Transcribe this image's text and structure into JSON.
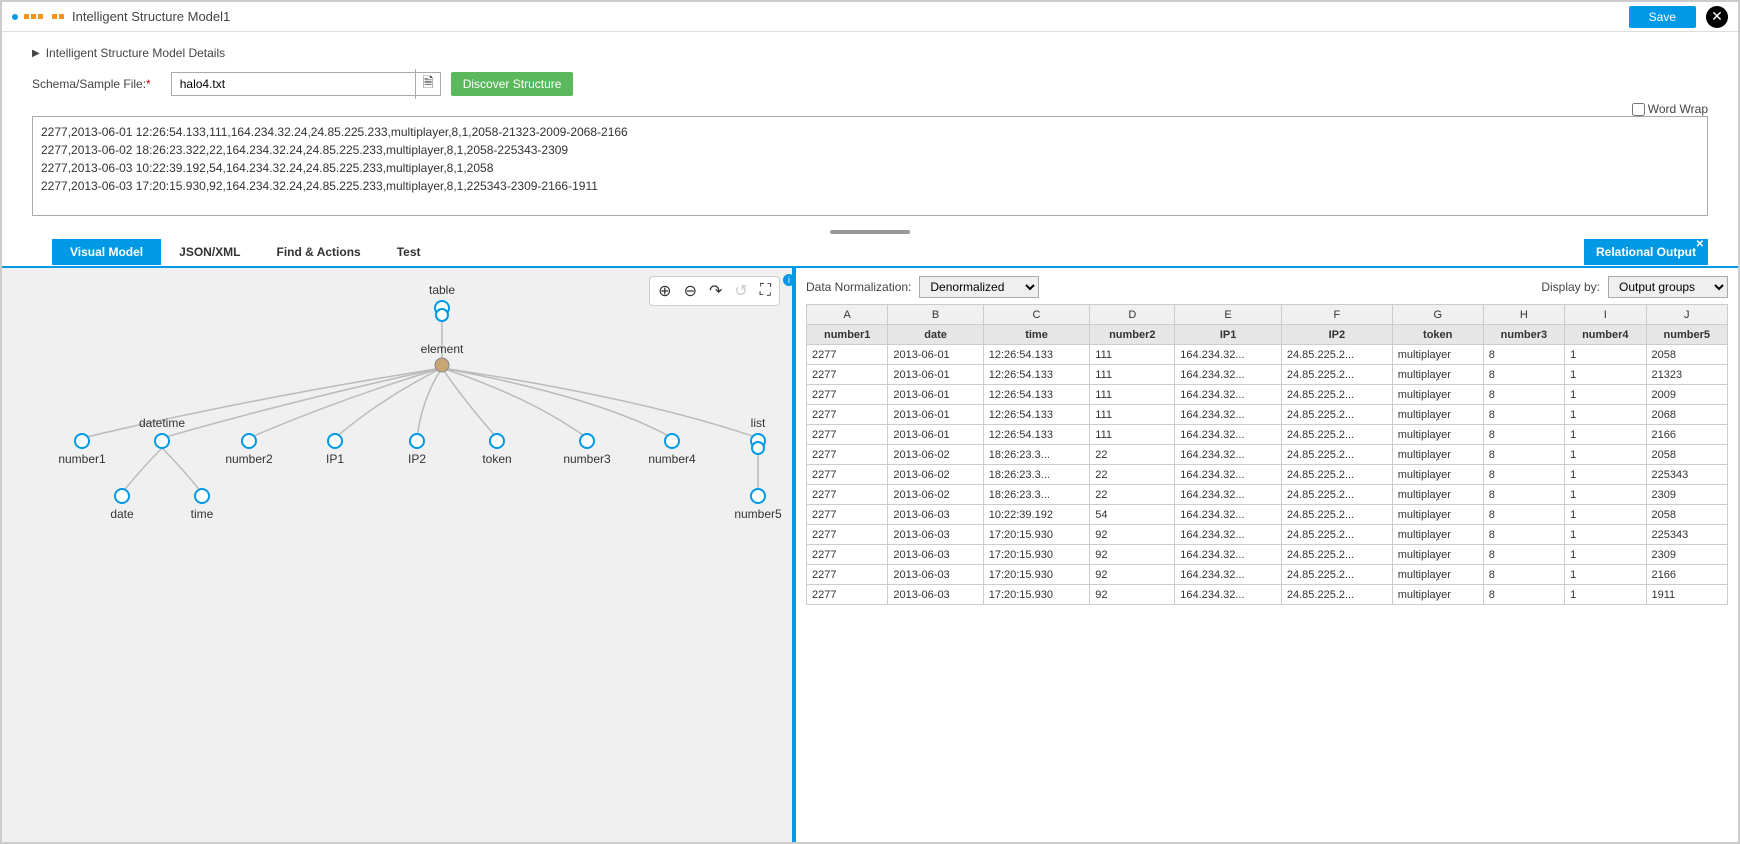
{
  "header": {
    "title": "Intelligent Structure Model1",
    "save_label": "Save"
  },
  "details": {
    "label": "Intelligent Structure Model Details"
  },
  "schema": {
    "label": "Schema/Sample File:",
    "filename": "halo4.txt",
    "discover_label": "Discover Structure",
    "wordwrap_label": "Word Wrap"
  },
  "sample_lines": [
    "2277,2013-06-01 12:26:54.133,111,164.234.32.24,24.85.225.233,multiplayer,8,1,2058-21323-2009-2068-2166",
    "2277,2013-06-02 18:26:23.322,22,164.234.32.24,24.85.225.233,multiplayer,8,1,2058-225343-2309",
    "2277,2013-06-03 10:22:39.192,54,164.234.32.24,24.85.225.233,multiplayer,8,1,2058",
    "2277,2013-06-03 17:20:15.930,92,164.234.32.24,24.85.225.233,multiplayer,8,1,225343-2309-2166-1911"
  ],
  "tabs": {
    "visual": "Visual Model",
    "json": "JSON/XML",
    "find": "Find & Actions",
    "test": "Test",
    "relational": "Relational Output"
  },
  "tree": {
    "table": "table",
    "element": "element",
    "number1": "number1",
    "datetime": "datetime",
    "number2": "number2",
    "ip1": "IP1",
    "ip2": "IP2",
    "token": "token",
    "number3": "number3",
    "number4": "number4",
    "list": "list",
    "date": "date",
    "time": "time",
    "number5": "number5"
  },
  "right": {
    "norm_label": "Data Normalization:",
    "norm_value": "Denormalized",
    "display_label": "Display by:",
    "display_value": "Output groups"
  },
  "grid": {
    "letters": [
      "A",
      "B",
      "C",
      "D",
      "E",
      "F",
      "G",
      "H",
      "I",
      "J"
    ],
    "headers": [
      "number1",
      "date",
      "time",
      "number2",
      "IP1",
      "IP2",
      "token",
      "number3",
      "number4",
      "number5"
    ],
    "rows": [
      [
        "2277",
        "2013-06-01",
        "12:26:54.133",
        "111",
        "164.234.32...",
        "24.85.225.2...",
        "multiplayer",
        "8",
        "1",
        "2058"
      ],
      [
        "2277",
        "2013-06-01",
        "12:26:54.133",
        "111",
        "164.234.32...",
        "24.85.225.2...",
        "multiplayer",
        "8",
        "1",
        "21323"
      ],
      [
        "2277",
        "2013-06-01",
        "12:26:54.133",
        "111",
        "164.234.32...",
        "24.85.225.2...",
        "multiplayer",
        "8",
        "1",
        "2009"
      ],
      [
        "2277",
        "2013-06-01",
        "12:26:54.133",
        "111",
        "164.234.32...",
        "24.85.225.2...",
        "multiplayer",
        "8",
        "1",
        "2068"
      ],
      [
        "2277",
        "2013-06-01",
        "12:26:54.133",
        "111",
        "164.234.32...",
        "24.85.225.2...",
        "multiplayer",
        "8",
        "1",
        "2166"
      ],
      [
        "2277",
        "2013-06-02",
        "18:26:23.3...",
        "22",
        "164.234.32...",
        "24.85.225.2...",
        "multiplayer",
        "8",
        "1",
        "2058"
      ],
      [
        "2277",
        "2013-06-02",
        "18:26:23.3...",
        "22",
        "164.234.32...",
        "24.85.225.2...",
        "multiplayer",
        "8",
        "1",
        "225343"
      ],
      [
        "2277",
        "2013-06-02",
        "18:26:23.3...",
        "22",
        "164.234.32...",
        "24.85.225.2...",
        "multiplayer",
        "8",
        "1",
        "2309"
      ],
      [
        "2277",
        "2013-06-03",
        "10:22:39.192",
        "54",
        "164.234.32...",
        "24.85.225.2...",
        "multiplayer",
        "8",
        "1",
        "2058"
      ],
      [
        "2277",
        "2013-06-03",
        "17:20:15.930",
        "92",
        "164.234.32...",
        "24.85.225.2...",
        "multiplayer",
        "8",
        "1",
        "225343"
      ],
      [
        "2277",
        "2013-06-03",
        "17:20:15.930",
        "92",
        "164.234.32...",
        "24.85.225.2...",
        "multiplayer",
        "8",
        "1",
        "2309"
      ],
      [
        "2277",
        "2013-06-03",
        "17:20:15.930",
        "92",
        "164.234.32...",
        "24.85.225.2...",
        "multiplayer",
        "8",
        "1",
        "2166"
      ],
      [
        "2277",
        "2013-06-03",
        "17:20:15.930",
        "92",
        "164.234.32...",
        "24.85.225.2...",
        "multiplayer",
        "8",
        "1",
        "1911"
      ]
    ]
  }
}
